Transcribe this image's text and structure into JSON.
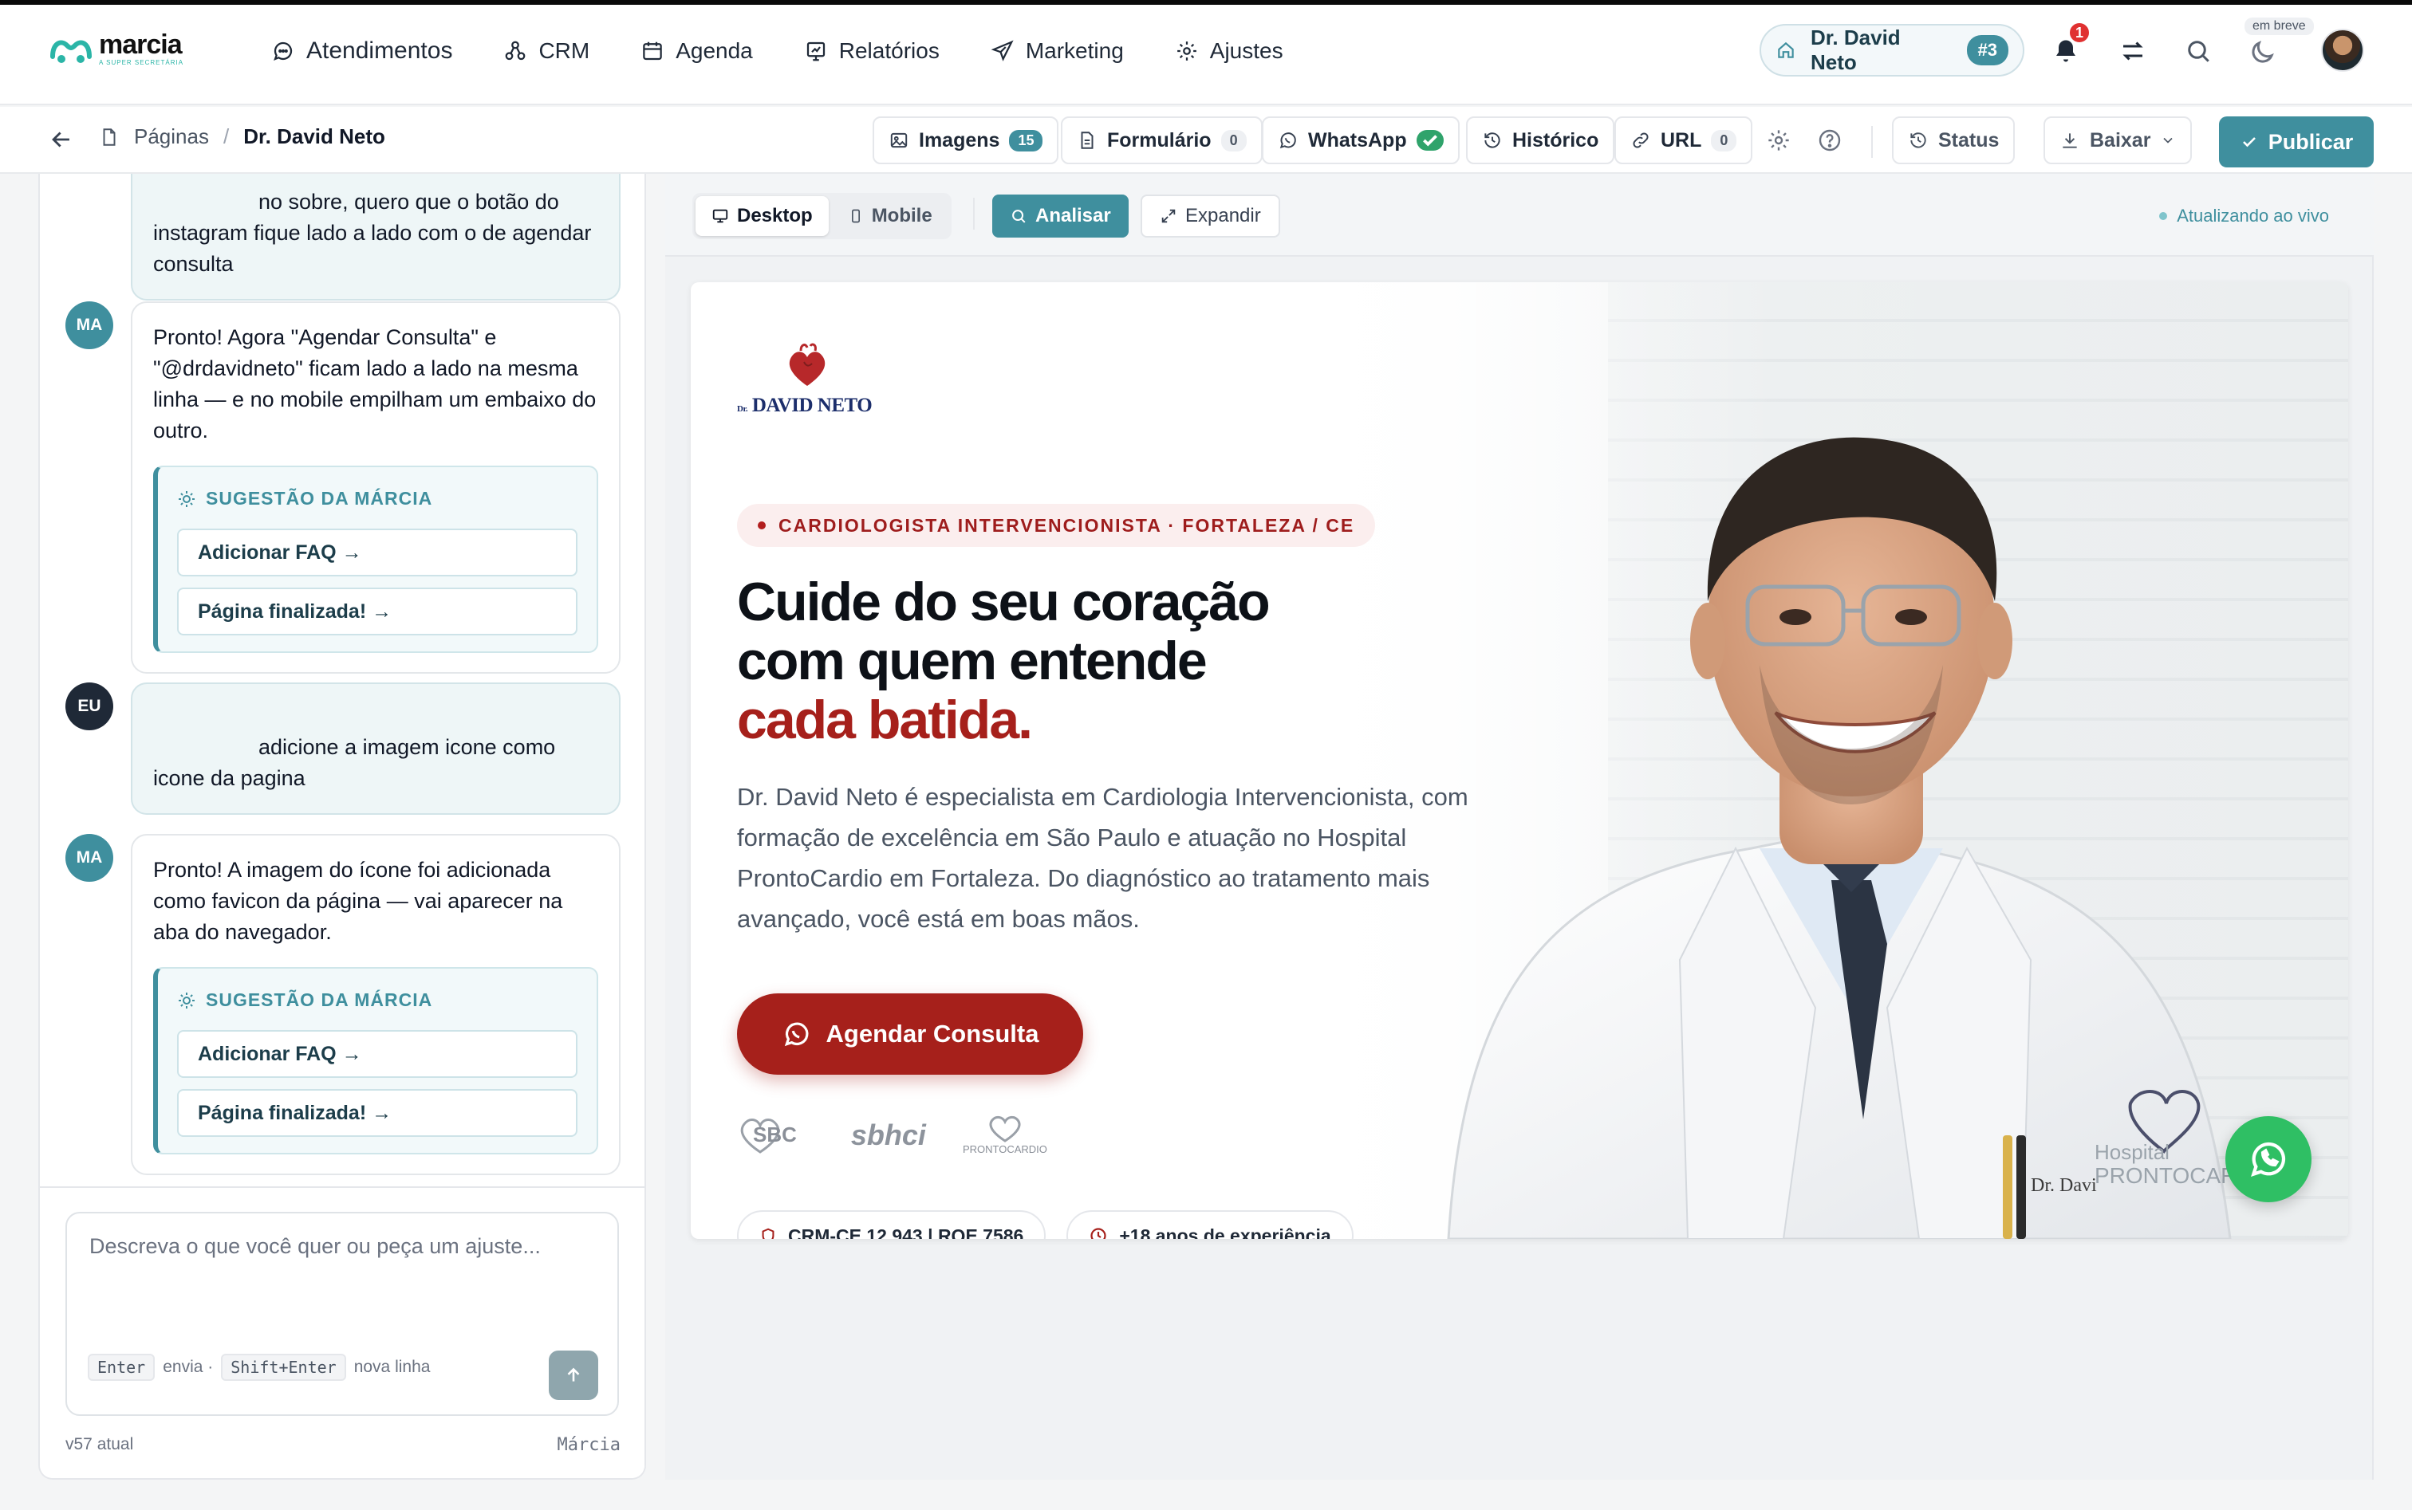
{
  "app": {
    "logo_text": "marcia",
    "logo_subtext": "A SUPER SECRETÁRIA",
    "nav": [
      {
        "label": "Atendimentos",
        "icon": "chat-icon"
      },
      {
        "label": "CRM",
        "icon": "nodes-icon"
      },
      {
        "label": "Agenda",
        "icon": "calendar-icon"
      },
      {
        "label": "Relatórios",
        "icon": "report-icon"
      },
      {
        "label": "Marketing",
        "icon": "send-icon"
      },
      {
        "label": "Ajustes",
        "icon": "gear-icon"
      }
    ],
    "account": {
      "name": "Dr. David Neto",
      "tag": "#3"
    },
    "notifications_count": "1",
    "coming_soon": "em breve"
  },
  "subbar": {
    "breadcrumb": {
      "root": "Páginas",
      "separator": "/",
      "current": "Dr. David Neto"
    },
    "tools": [
      {
        "label": "Imagens",
        "count": "15"
      },
      {
        "label": "Formulário",
        "count": "0"
      },
      {
        "label": "WhatsApp",
        "status": "ok"
      },
      {
        "label": "Histórico"
      },
      {
        "label": "URL",
        "count": "0"
      }
    ],
    "status_label": "Status",
    "download_label": "Baixar",
    "publish_label": "Publicar"
  },
  "chat": {
    "messages": [
      {
        "author": "EU",
        "text": "no sobre, quero que o botão do instagram fique lado a lado com o de agendar consulta"
      },
      {
        "author": "MA",
        "text": "Pronto! Agora \"Agendar Consulta\" e \"@drdavidneto\" ficam lado a lado na mesma linha — e no mobile empilham um embaixo do outro.",
        "suggestion_title": "SUGESTÃO DA MÁRCIA",
        "suggestions": [
          "Adicionar FAQ →",
          "Página finalizada! →"
        ]
      },
      {
        "author": "EU",
        "text": "adicione a imagem icone como icone da pagina"
      },
      {
        "author": "MA",
        "text": "Pronto! A imagem do ícone foi adicionada como favicon da página — vai aparecer na aba do navegador.",
        "suggestion_title": "SUGESTÃO DA MÁRCIA",
        "suggestions": [
          "Adicionar FAQ →",
          "Página finalizada! →"
        ]
      }
    ],
    "input_placeholder": "Descreva o que você quer ou peça um ajuste...",
    "hint_key1": "Enter",
    "hint_text1": "envia ·",
    "hint_key2": "Shift+Enter",
    "hint_text2": "nova linha",
    "version": "v57 atual",
    "assistant_name": "Márcia"
  },
  "preview": {
    "view_desktop": "Desktop",
    "view_mobile": "Mobile",
    "analyze_label": "Analisar",
    "expand_label": "Expandir",
    "live_status": "Atualizando ao vivo"
  },
  "landing": {
    "brand_prefix": "Dr.",
    "brand_name": "DAVID NETO",
    "eyebrow": "CARDIOLOGISTA INTERVENCIONISTA · FORTALEZA / CE",
    "headline_1": "Cuide do seu coração",
    "headline_2": "com quem entende",
    "headline_accent": "cada batida.",
    "lead": "Dr. David Neto é especialista em Cardiologia Intervencionista, com formação de excelência em São Paulo e atuação no Hospital ProntoCardio em Fortaleza. Do diagnóstico ao tratamento mais avançado, você está em boas mãos.",
    "cta_label": "Agendar Consulta",
    "associations": [
      "SBC",
      "sbhci",
      "PRONTOCARDIO"
    ],
    "badges": [
      "CRM-CE 12.943 | RQE 7586",
      "+18 anos de experiência"
    ],
    "accent_color": "#a6201b",
    "brand_color": "#3f8f9e"
  }
}
